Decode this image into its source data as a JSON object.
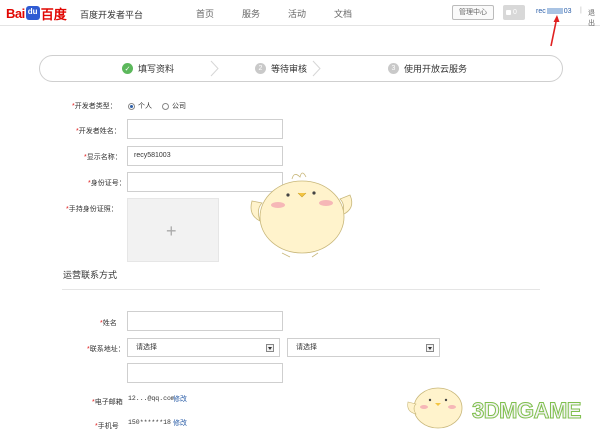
{
  "header": {
    "logo_bai": "Bai",
    "logo_cn": "百度",
    "logo_subtitle": "百度开发者平台",
    "nav": [
      "首页",
      "服务",
      "活动",
      "文档"
    ],
    "manage_button": "管理中心",
    "message_count": "0",
    "username_start": "rec",
    "username_end": "03",
    "separator": "|",
    "logout": "退出",
    "accent_color": "#e10602",
    "link_color": "#2b5ea8"
  },
  "steps": {
    "items": [
      {
        "label": "填写资料",
        "marker": "✓",
        "state": "done"
      },
      {
        "label": "等待审核",
        "marker": "2",
        "state": "pending"
      },
      {
        "label": "使用开放云服务",
        "marker": "3",
        "state": "pending"
      }
    ],
    "done_color": "#5cb85c",
    "pending_color": "#c9c9c9"
  },
  "form": {
    "required_mark": "*",
    "developer_type_label": "开发者类型：",
    "developer_type_options": [
      "个人",
      "公司"
    ],
    "developer_type_selected": "个人",
    "developer_name_label": "开发者姓名：",
    "developer_name_value": "",
    "display_name_label": "显示名称：",
    "display_name_value": "recy581003",
    "id_number_label": "身份证号：",
    "id_number_value": "",
    "id_photo_label": "手持身份证照：",
    "upload_plus": "+"
  },
  "contact": {
    "section_title": "运营联系方式",
    "name_label": "姓名",
    "name_value": "",
    "address_label": "联系地址：",
    "province_placeholder": "请选择",
    "city_placeholder": "请选择",
    "address_detail_value": "",
    "email_label": "电子邮箱",
    "email_value": "12...@qq.com",
    "email_edit": "修改",
    "phone_label": "手机号",
    "phone_value": "150******18",
    "phone_edit": "修改"
  },
  "watermark": "3DMGAME"
}
